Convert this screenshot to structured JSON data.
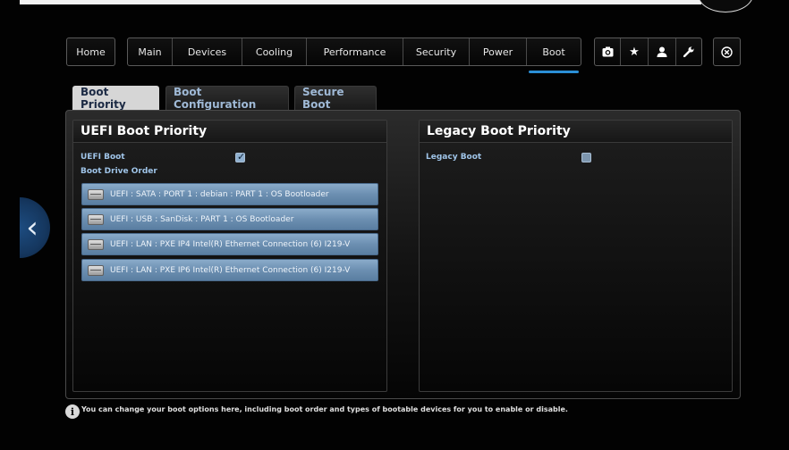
{
  "nav": {
    "home": "Home",
    "tabs": [
      "Main",
      "Devices",
      "Cooling",
      "Performance",
      "Security",
      "Power",
      "Boot"
    ],
    "active_tab": "Boot",
    "icons": [
      "camera-icon",
      "star-icon",
      "user-icon",
      "wrench-icon"
    ],
    "close_icon": "close-icon"
  },
  "subtabs": {
    "boot_priority": "Boot Priority",
    "boot_configuration": "Boot Configuration",
    "secure_boot": "Secure Boot"
  },
  "uefi_panel": {
    "title": "UEFI Boot Priority",
    "uefi_boot_label": "UEFI Boot",
    "uefi_boot_checked": true,
    "drive_order_label": "Boot Drive Order",
    "items": [
      "UEFI : SATA : PORT 1 : debian : PART 1 : OS Bootloader",
      "UEFI : USB : SanDisk : PART 1 : OS Bootloader",
      "UEFI : LAN : PXE IP4 Intel(R) Ethernet Connection (6) I219-V",
      "UEFI : LAN : PXE IP6 Intel(R) Ethernet Connection (6) I219-V"
    ]
  },
  "legacy_panel": {
    "title": "Legacy Boot Priority",
    "legacy_boot_label": "Legacy Boot",
    "legacy_boot_checked": false
  },
  "info": {
    "icon": "info-icon",
    "text": "You can change your boot options here, including boot order and types of bootable devices for you to enable or disable."
  },
  "colors": {
    "accent": "#2b8fd6",
    "item_blue": "#6c8fb1",
    "label_blue": "#9fc4e8"
  }
}
